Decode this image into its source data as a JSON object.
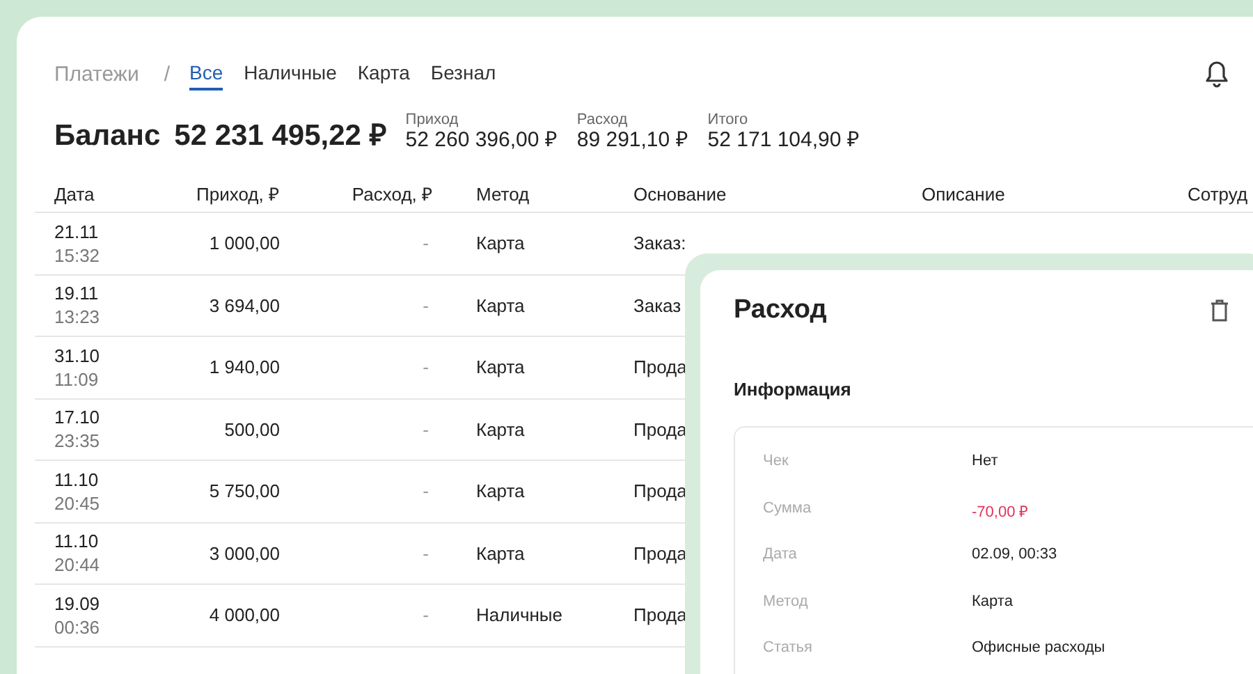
{
  "breadcrumb": {
    "root": "Платежи",
    "separator": "/"
  },
  "tabs": [
    {
      "label": "Все",
      "selected": true
    },
    {
      "label": "Наличные",
      "selected": false
    },
    {
      "label": "Карта",
      "selected": false
    },
    {
      "label": "Безнал",
      "selected": false
    }
  ],
  "balance": {
    "label": "Баланс",
    "value": "52 231 495,22 ₽"
  },
  "totals": [
    {
      "label": "Приход",
      "value": "52 260 396,00 ₽"
    },
    {
      "label": "Расход",
      "value": "89 291,10 ₽"
    },
    {
      "label": "Итого",
      "value": "52 171 104,90 ₽"
    }
  ],
  "table": {
    "columns": [
      "Дата",
      "Приход, ₽",
      "Расход, ₽",
      "Метод",
      "Основание",
      "Описание",
      "Сотруд"
    ],
    "rows": [
      {
        "date": "21.11",
        "time": "15:32",
        "income": "1 000,00",
        "expense": "-",
        "method": "Карта",
        "basis": "Заказ:"
      },
      {
        "date": "19.11",
        "time": "13:23",
        "income": "3 694,00",
        "expense": "-",
        "method": "Карта",
        "basis": "Заказ"
      },
      {
        "date": "31.10",
        "time": "11:09",
        "income": "1 940,00",
        "expense": "-",
        "method": "Карта",
        "basis": "Прода"
      },
      {
        "date": "17.10",
        "time": "23:35",
        "income": "500,00",
        "expense": "-",
        "method": "Карта",
        "basis": "Прода"
      },
      {
        "date": "11.10",
        "time": "20:45",
        "income": "5 750,00",
        "expense": "-",
        "method": "Карта",
        "basis": "Прода"
      },
      {
        "date": "11.10",
        "time": "20:44",
        "income": "3 000,00",
        "expense": "-",
        "method": "Карта",
        "basis": "Прода"
      },
      {
        "date": "19.09",
        "time": "00:36",
        "income": "4 000,00",
        "expense": "-",
        "method": "Наличные",
        "basis": "Прода"
      }
    ]
  },
  "panel": {
    "title": "Расход",
    "section": "Информация",
    "fields": [
      {
        "label": "Чек",
        "value": "Нет",
        "kind": "text"
      },
      {
        "label": "Сумма",
        "value": "-70,00 ₽",
        "kind": "amount"
      },
      {
        "label": "Дата",
        "value": "02.09, 00:33",
        "kind": "text"
      },
      {
        "label": "Метод",
        "value": "Карта",
        "kind": "text"
      },
      {
        "label": "Статья",
        "value": "Офисные расходы",
        "kind": "text"
      }
    ]
  }
}
